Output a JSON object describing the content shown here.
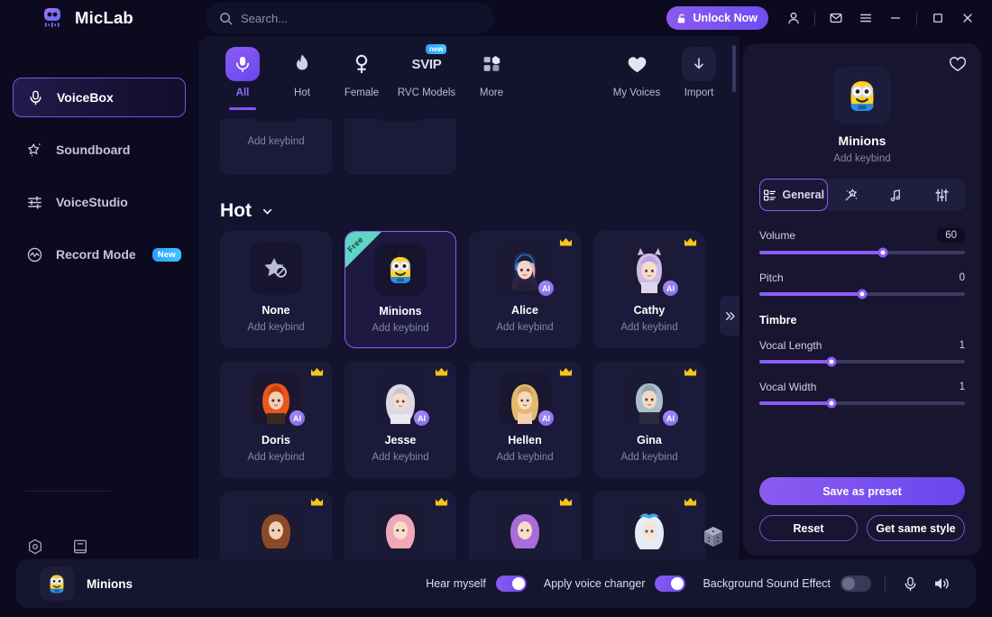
{
  "app": {
    "name": "MicLab",
    "logo_icon": "robot-logo-icon"
  },
  "titlebar": {
    "search": {
      "placeholder": "Search...",
      "value": "",
      "icon": "search-icon"
    },
    "unlock_label": "Unlock Now",
    "unlock_icon": "lock-open-icon",
    "account_icon": "user-icon",
    "mail_icon": "mail-icon",
    "menu_icon": "hamburger-menu-icon",
    "minimize_icon": "minimize-icon",
    "maximize_icon": "maximize-icon",
    "close_icon": "close-icon"
  },
  "sidebar": {
    "items": [
      {
        "label": "VoiceBox",
        "icon": "microphone-icon",
        "active": true,
        "badge": ""
      },
      {
        "label": "Soundboard",
        "icon": "magic-wand-star-icon",
        "active": false,
        "badge": ""
      },
      {
        "label": "VoiceStudio",
        "icon": "sliders-icon",
        "active": false,
        "badge": ""
      },
      {
        "label": "Record Mode",
        "icon": "record-waveform-icon",
        "active": false,
        "badge": "New"
      }
    ],
    "bottom_icons": [
      {
        "name": "settings-gear-icon"
      },
      {
        "name": "manual-book-icon"
      }
    ]
  },
  "categories": [
    {
      "label": "All",
      "icon": "microphone-icon",
      "selected": true,
      "badge": ""
    },
    {
      "label": "Hot",
      "icon": "flame-icon",
      "selected": false,
      "badge": ""
    },
    {
      "label": "Female",
      "icon": "female-venus-icon",
      "selected": false,
      "badge": ""
    },
    {
      "label": "RVC Models",
      "icon": "svip-text-icon",
      "selected": false,
      "badge": "new"
    },
    {
      "label": "More",
      "icon": "grid-squares-icon",
      "selected": false,
      "badge": ""
    }
  ],
  "category_actions": [
    {
      "label": "My Voices",
      "icon": "heart-filled-icon"
    },
    {
      "label": "Import",
      "icon": "download-arrow-icon"
    }
  ],
  "grid": {
    "section_title": "Hot",
    "section_chevron": "chevron-down-icon",
    "keybind_label": "Add keybind",
    "expand_icon": "double-chevron-right-icon",
    "dice_icon": "dice-random-icon",
    "rows": [
      {
        "partial": true,
        "cards": [
          {
            "name": "",
            "avatar": "",
            "keybind": "Add keybind",
            "crown": false,
            "ai": false,
            "free": false,
            "selected": false
          },
          {
            "name": "",
            "avatar": "",
            "keybind": "",
            "crown": false,
            "ai": false,
            "free": false,
            "selected": false
          }
        ]
      },
      {
        "partial": false,
        "cards": [
          {
            "name": "None",
            "avatar": "star-slash-icon",
            "keybind": "Add keybind",
            "crown": false,
            "ai": false,
            "free": false,
            "selected": false
          },
          {
            "name": "Minions",
            "avatar": "🙂",
            "keybind": "Add keybind",
            "crown": false,
            "ai": false,
            "free": true,
            "free_label": "Free",
            "selected": true
          },
          {
            "name": "Alice",
            "avatar": "👩",
            "keybind": "Add keybind",
            "crown": true,
            "ai": true,
            "ai_label": "AI",
            "free": false,
            "selected": false
          },
          {
            "name": "Cathy",
            "avatar": "👧",
            "keybind": "Add keybind",
            "crown": true,
            "ai": true,
            "ai_label": "AI",
            "free": false,
            "selected": false
          }
        ]
      },
      {
        "partial": false,
        "cards": [
          {
            "name": "Doris",
            "avatar": "👩‍🦰",
            "keybind": "Add keybind",
            "crown": true,
            "ai": true,
            "ai_label": "AI",
            "free": false,
            "selected": false
          },
          {
            "name": "Jesse",
            "avatar": "👱‍♀️",
            "keybind": "Add keybind",
            "crown": true,
            "ai": true,
            "ai_label": "AI",
            "free": false,
            "selected": false
          },
          {
            "name": "Hellen",
            "avatar": "💁‍♀️",
            "keybind": "Add keybind",
            "crown": true,
            "ai": true,
            "ai_label": "AI",
            "free": false,
            "selected": false
          },
          {
            "name": "Gina",
            "avatar": "👩‍🦳",
            "keybind": "Add keybind",
            "crown": true,
            "ai": true,
            "ai_label": "AI",
            "free": false,
            "selected": false
          }
        ]
      },
      {
        "partial": true,
        "cards": [
          {
            "name": "",
            "avatar": "👩‍🦱",
            "keybind": "",
            "crown": true,
            "ai": false,
            "free": false,
            "selected": false
          },
          {
            "name": "",
            "avatar": "👩",
            "keybind": "",
            "crown": true,
            "ai": false,
            "free": false,
            "selected": false
          },
          {
            "name": "",
            "avatar": "🧝‍♀️",
            "keybind": "",
            "crown": true,
            "ai": false,
            "free": false,
            "selected": false
          },
          {
            "name": "",
            "avatar": "👸",
            "keybind": "",
            "crown": true,
            "ai": false,
            "free": false,
            "selected": false
          }
        ]
      }
    ]
  },
  "detail": {
    "favorite_icon": "heart-outline-icon",
    "avatar": "🙂",
    "name": "Minions",
    "keybind": "Add keybind",
    "tabs": [
      {
        "label": "General",
        "icon": "grid-list-icon",
        "active": true
      },
      {
        "label": "",
        "icon": "magic-wand-icon",
        "active": false
      },
      {
        "label": "",
        "icon": "music-note-icon",
        "active": false
      },
      {
        "label": "",
        "icon": "equalizer-sliders-icon",
        "active": false
      }
    ],
    "sliders": [
      {
        "label": "Volume",
        "value": "60",
        "fill_pct": 60,
        "boxed": true
      },
      {
        "label": "Pitch",
        "value": "0",
        "fill_pct": 50,
        "boxed": false
      }
    ],
    "timbre_title": "Timbre",
    "timbre_sliders": [
      {
        "label": "Vocal Length",
        "value": "1",
        "fill_pct": 35,
        "boxed": false
      },
      {
        "label": "Vocal Width",
        "value": "1",
        "fill_pct": 35,
        "boxed": false
      }
    ],
    "save_label": "Save as preset",
    "reset_label": "Reset",
    "same_style_label": "Get same style"
  },
  "bottombar": {
    "avatar": "🙂",
    "voice_name": "Minions",
    "toggles": [
      {
        "label": "Hear myself",
        "on": true
      },
      {
        "label": "Apply voice changer",
        "on": true
      },
      {
        "label": "Background Sound Effect",
        "on": false
      }
    ],
    "mic_icon": "microphone-icon",
    "speaker_icon": "speaker-volume-icon"
  },
  "colors": {
    "accent": "#8b5cf6",
    "accent_dark": "#6a46ef",
    "bg": "#0b0a1e",
    "panel": "#14132e",
    "panel_right": "#17152f",
    "card": "#1b1a3a",
    "free_ribbon": "#5fd6c4",
    "badge_new": "#2f9bff",
    "crown": "#f5c518"
  }
}
